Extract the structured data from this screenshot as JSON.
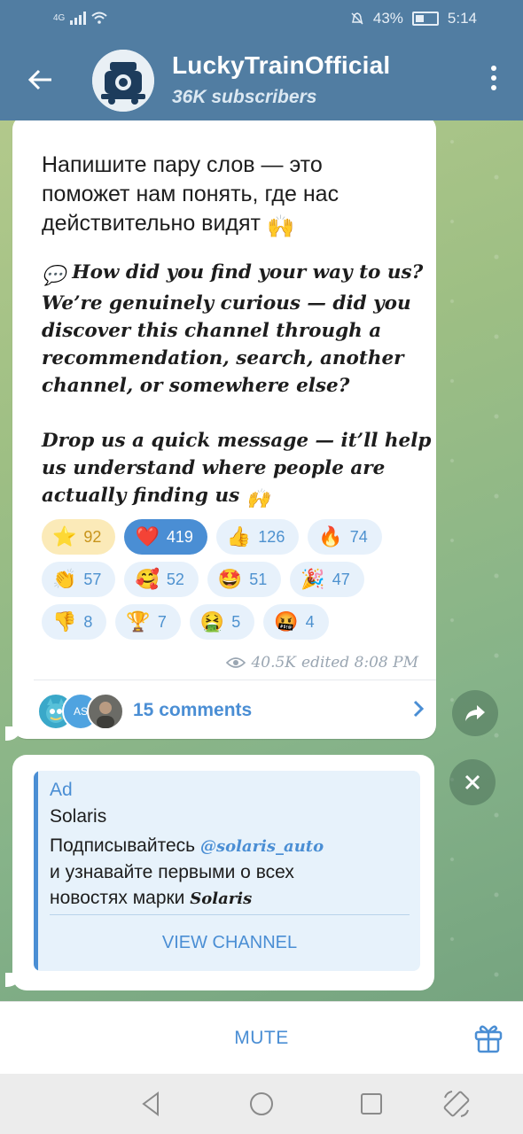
{
  "status_bar": {
    "network": "4G",
    "battery_percent": "43%",
    "time": "5:14"
  },
  "header": {
    "title": "LuckyTrainOfficial",
    "subtitle": "36K subscribers"
  },
  "message": {
    "ru_text_line1": "Напишите пару слов — это",
    "ru_text_line2": "поможет нам понять, где нас",
    "ru_text_line3": "действительно видят",
    "en_paragraph1": "How did you find your way to us? We’re genuinely curious — did you discover this channel through a recommendation, search, another channel, or somewhere else?",
    "en_paragraph2": "Drop us a quick message — it’ll help us understand where people are actually finding us",
    "reactions": [
      {
        "emoji": "⭐",
        "count": "92"
      },
      {
        "emoji": "❤️",
        "count": "419"
      },
      {
        "emoji": "👍",
        "count": "126"
      },
      {
        "emoji": "🔥",
        "count": "74"
      },
      {
        "emoji": "👏",
        "count": "57"
      },
      {
        "emoji": "🥰",
        "count": "52"
      },
      {
        "emoji": "🤩",
        "count": "51"
      },
      {
        "emoji": "🎉",
        "count": "47"
      },
      {
        "emoji": "👎",
        "count": "8"
      },
      {
        "emoji": "🏆",
        "count": "7"
      },
      {
        "emoji": "🤮",
        "count": "5"
      },
      {
        "emoji": "🤬",
        "count": "4"
      }
    ],
    "views": "40.5K",
    "edited_label": "edited 8:08 PM",
    "comments_label": "15 comments",
    "commenter_initials": "AS"
  },
  "ad": {
    "label": "Ad",
    "name": "Solaris",
    "text_start": "Подписывайтесь",
    "mention": "@solaris_auto",
    "text_mid": "и узнавайте первыми о всех",
    "text_end": "новостях марки",
    "brand": "Solaris",
    "button": "VIEW CHANNEL"
  },
  "bottom": {
    "mute_label": "MUTE"
  },
  "colors": {
    "header": "#517da2",
    "accent": "#4a8ed4",
    "selected_reaction": "#4a8ed4",
    "star_reaction": "#fbeab8"
  },
  "icons": [
    "back-arrow-icon",
    "more-vert-icon",
    "eye-icon",
    "chevron-right-icon",
    "share-icon",
    "close-icon",
    "gift-icon",
    "nav-back-icon",
    "nav-home-icon",
    "nav-recents-icon",
    "rotate-icon"
  ]
}
